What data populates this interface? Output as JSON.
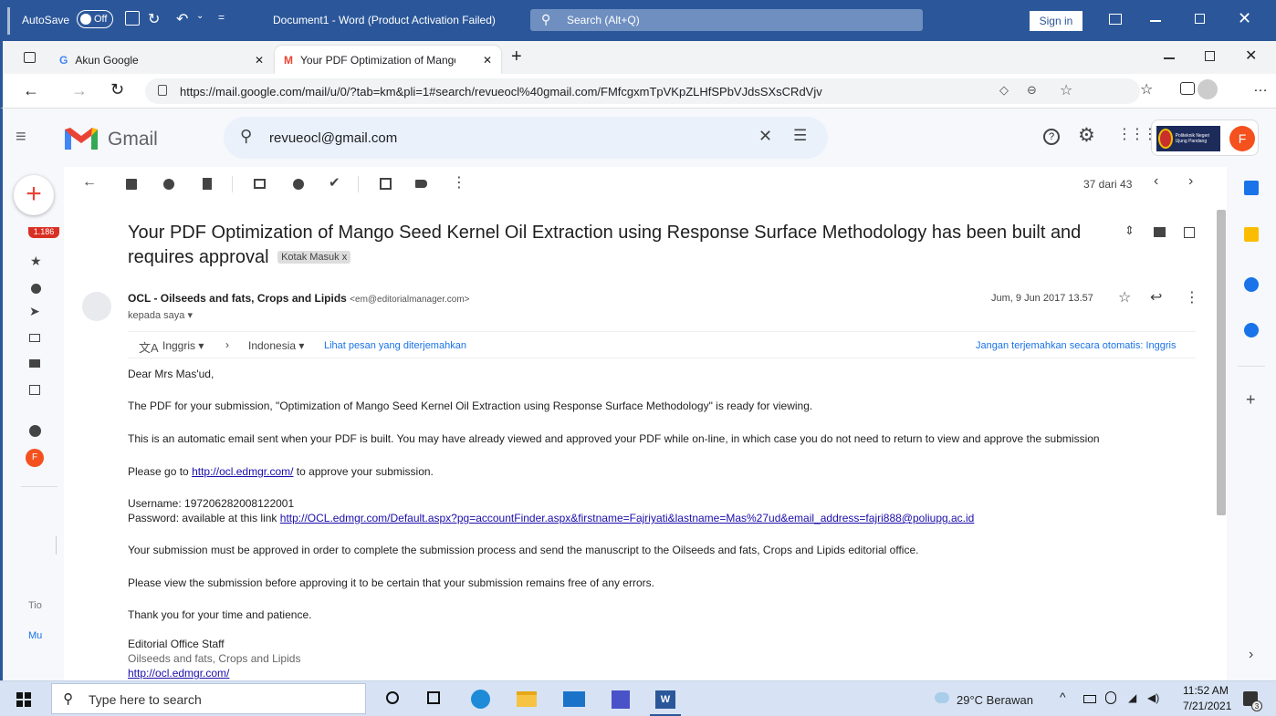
{
  "word": {
    "autosave": "AutoSave",
    "toggle": "Off",
    "doc_title": "Document1  -  Word (Product Activation Failed)",
    "search": "Search (Alt+Q)",
    "signin": "Sign in"
  },
  "browser": {
    "tabs": [
      {
        "label": "Akun Google",
        "icon": "google-icon"
      },
      {
        "label": "Your PDF Optimization of Mango",
        "icon": "gmail-icon"
      }
    ],
    "url": "https://mail.google.com/mail/u/0/?tab=km&pli=1#search/revueocl%40gmail.com/FMfcgxmTpVKpZLHfSPbVJdsSXsCRdVjv"
  },
  "gmail": {
    "app_name": "Gmail",
    "search_query": "revueocl@gmail.com",
    "avatar_letter": "F",
    "org_badge": "Politeknik Negeri Ujung Pandang",
    "pagination": "37 dari 43"
  },
  "leftrail": {
    "badge": "1.186",
    "avatar_letter": "F",
    "trunc1": "Tio",
    "trunc2": "Mu"
  },
  "email": {
    "subject": "Your PDF Optimization of Mango Seed Kernel Oil Extraction using Response Surface Methodology has been built and requires approval",
    "label": "Kotak Masuk",
    "label_close": "x",
    "sender_name": "OCL - Oilseeds and fats, Crops and Lipids",
    "sender_email": "<em@editorialmanager.com>",
    "to": "kepada saya",
    "date": "Jum, 9 Jun 2017 13.57"
  },
  "translate": {
    "from": "Inggris",
    "to": "Indonesia",
    "view": "Lihat pesan yang diterjemahkan",
    "no_translate": "Jangan terjemahkan secara otomatis: Inggris"
  },
  "body": {
    "greeting": "Dear Mrs Mas'ud,",
    "p1": "The PDF for your submission, \"Optimization of Mango Seed Kernel Oil Extraction using Response Surface Methodology\" is ready for viewing.",
    "p2": "This is an automatic email sent when your PDF is built. You may have already viewed and approved your PDF while on-line, in which case you do not need to return to view and approve the submission",
    "p3_pre": "Please go to",
    "p3_link": "http://ocl.edmgr.com/",
    "p3_post": "to approve your submission.",
    "username": "Username: 197206282008122001",
    "password_pre": "Password: available at this link",
    "password_link": "http://OCL.edmgr.com/Default.aspx?pg=accountFinder.aspx&firstname=Fajriyati&lastname=Mas%27ud&email_address=fajri888@poliupg.ac.id",
    "p4": "Your submission must be approved in order to complete the submission process and send the manuscript to the Oilseeds and fats, Crops and Lipids editorial office.",
    "p5": "Please view the submission before approving it to be certain that your submission remains free of any errors.",
    "p6": "Thank you for your time and patience.",
    "sig1": "Editorial Office Staff",
    "sig2": "Oilseeds and fats, Crops and Lipids",
    "sig3": "http://ocl.edmgr.com/"
  },
  "taskbar": {
    "search_placeholder": "Type here to search",
    "weather": "29°C  Berawan",
    "time": "11:52 AM",
    "date": "7/21/2021",
    "notif": "3"
  },
  "colors": {
    "word_blue": "#2b579a",
    "gmail_red": "#ea4335",
    "avatar_orange": "#f4511e",
    "link": "#1a0dab"
  }
}
